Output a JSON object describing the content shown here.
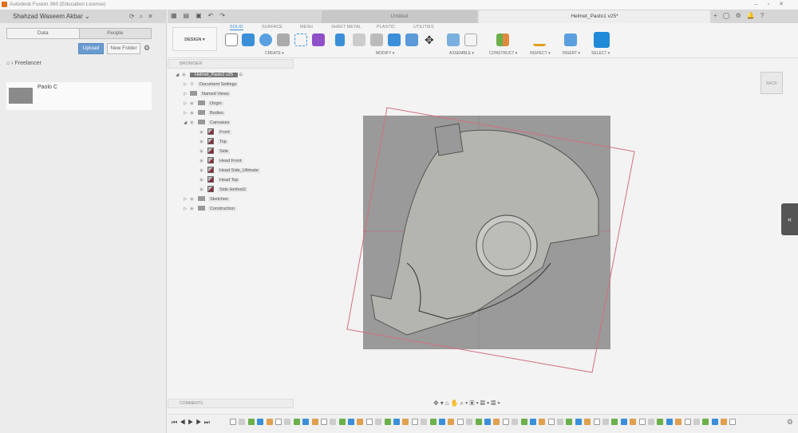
{
  "window": {
    "title": "Autodesk Fusion 360 (Education License)"
  },
  "left_panel": {
    "user": "Shahzad Waseem Akbar",
    "tabs": [
      "Data",
      "People"
    ],
    "upload": "Upload",
    "new_folder": "New Folder",
    "breadcrumb": "Freelancer",
    "folder": "Paolo C"
  },
  "doc_tabs": [
    {
      "label": "Untitled"
    },
    {
      "label": "Helmet_Paolo1 v25*"
    }
  ],
  "toolbar": {
    "workspace": "DESIGN ▾",
    "tabs": [
      "SOLID",
      "SURFACE",
      "MESH",
      "SHEET METAL",
      "PLASTIC",
      "UTILITIES"
    ],
    "groups": [
      "CREATE ▾",
      "MODIFY ▾",
      "ASSEMBLE ▾",
      "CONSTRUCT ▾",
      "INSPECT ▾",
      "INSERT ▾",
      "SELECT ▾"
    ]
  },
  "browser": {
    "title": "BROWSER",
    "root": "Helmet_Paolo1 v25",
    "items": [
      "Document Settings",
      "Named Views",
      "Origin",
      "Bodies",
      "Canvases",
      "Sketches",
      "Construction"
    ],
    "canvases": [
      "Front",
      "Top",
      "Side",
      "Head Front",
      "Head Side_Ultimate",
      "Head Top",
      "Side Helmet2"
    ]
  },
  "comments": {
    "title": "COMMENTS"
  },
  "viewcube": {
    "face": "BACK"
  },
  "colors": {
    "accent": "#3a8fd8",
    "upload": "#6a9bd0"
  }
}
